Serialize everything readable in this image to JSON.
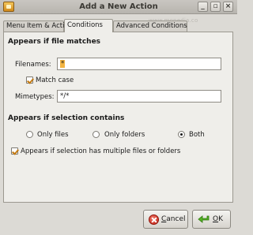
{
  "window": {
    "title": "Add a New Action"
  },
  "watermark": "www.mopedia.co",
  "tabs": [
    {
      "label": "Menu Item & Action",
      "active": false
    },
    {
      "label": "Conditions",
      "active": true
    },
    {
      "label": "Advanced Conditions",
      "active": false
    }
  ],
  "file_match": {
    "heading": "Appears if file matches",
    "filenames_label": "Filenames:",
    "filenames_value": "*",
    "match_case_label": "Match case",
    "match_case_checked": true,
    "mimetypes_label": "Mimetypes:",
    "mimetypes_value": "*/*"
  },
  "selection": {
    "heading": "Appears if selection contains",
    "options": [
      {
        "label": "Only files",
        "selected": false
      },
      {
        "label": "Only folders",
        "selected": false
      },
      {
        "label": "Both",
        "selected": true
      }
    ],
    "multiple_label": "Appears if selection has multiple files or folders",
    "multiple_checked": true
  },
  "buttons": {
    "cancel_prefix": "C",
    "cancel_rest": "ancel",
    "ok_prefix": "O",
    "ok_rest": "K"
  },
  "colors": {
    "accent": "#f3b441",
    "ok_icon": "#55b224",
    "cancel_icon": "#c11f12"
  }
}
